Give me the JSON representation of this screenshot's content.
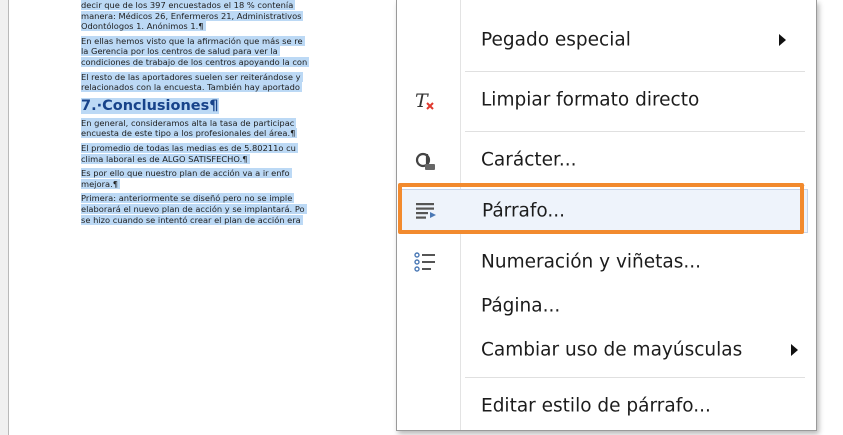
{
  "document": {
    "paragraphs": [
      [
        "decir que de los 397 encuestados el 18 % contenía",
        "manera: Médicos 26, Enfermeros 21, Administrativos",
        "Odontólogos 1. Anónimos 1.¶"
      ],
      [
        "En ellas hemos visto que la afirmación que más se re",
        "la Gerencia por los centros de salud para ver la",
        "condiciones de trabajo de los centros apoyando la con"
      ],
      [
        "El resto de las aportadores suelen ser reiterándose y",
        "relacionados con la encuesta. También hay aportado"
      ]
    ],
    "heading": "7.·Conclusiones¶",
    "paragraphs2": [
      [
        "En general, consideramos alta la tasa de participac",
        "encuesta de este tipo a los profesionales del área.¶"
      ],
      [
        "El promedio de todas las medias es de 5.80211o cu",
        "clima laboral es de ALGO SATISFECHO.¶"
      ],
      [
        "Es por ello que nuestro plan de acción va a ir enfo",
        "mejora.¶"
      ],
      [
        "Primera: anteriormente se diseñó pero no se imple",
        "elaborará el nuevo plan de acción y se implantará. Po",
        "se hizo cuando se intentó crear el plan de acción era"
      ]
    ]
  },
  "menu": {
    "items": [
      {
        "label": "Pegado especial",
        "icon": "",
        "submenu": true
      },
      {
        "label": "Limpiar formato directo",
        "icon": "clear-formatting-icon",
        "submenu": false
      },
      {
        "label": "Carácter...",
        "icon": "character-icon",
        "submenu": false
      },
      {
        "label": "Párrafo...",
        "icon": "paragraph-icon",
        "submenu": false,
        "highlighted": true
      },
      {
        "label": "Numeración y viñetas...",
        "icon": "bullets-numbering-icon",
        "submenu": false
      },
      {
        "label": "Página...",
        "icon": "",
        "submenu": false
      },
      {
        "label": "Cambiar uso de mayúsculas",
        "icon": "",
        "submenu": true
      },
      {
        "label": "Editar estilo de párrafo...",
        "icon": "",
        "submenu": false
      }
    ]
  },
  "colors": {
    "highlight_border": "#f28a2e",
    "selection": "#bcd9f5",
    "heading": "#17438a"
  }
}
